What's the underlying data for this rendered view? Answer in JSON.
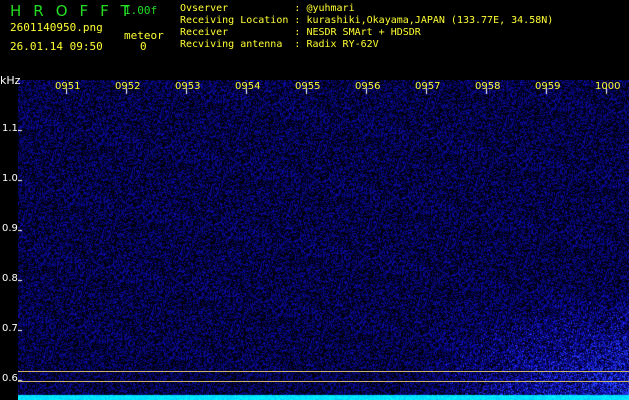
{
  "header": {
    "title": "HROFFT",
    "version": "1.00f",
    "filename": "2601140950.png",
    "datetime": "26.01.14 09:50",
    "meteor_label": "meteor",
    "meteor_count": "0"
  },
  "info": [
    {
      "label": "Ovserver          ",
      "value": "@yuhmari"
    },
    {
      "label": "Receiving Location",
      "value": "kurashiki,Okayama,JAPAN (133.77E, 34.58N)"
    },
    {
      "label": "Receiver          ",
      "value": "NESDR SMArt + HDSDR"
    },
    {
      "label": "Recviving antenna ",
      "value": "Radix RY-62V"
    }
  ],
  "axis": {
    "unit": "kHz",
    "freq_labels": [
      "1.1",
      "1.0",
      "0.9",
      "0.8",
      "0.7",
      "0.6"
    ],
    "time_labels": [
      "0951",
      "0952",
      "0953",
      "0954",
      "0955",
      "0956",
      "0957",
      "0958",
      "0959",
      "1000"
    ]
  }
}
